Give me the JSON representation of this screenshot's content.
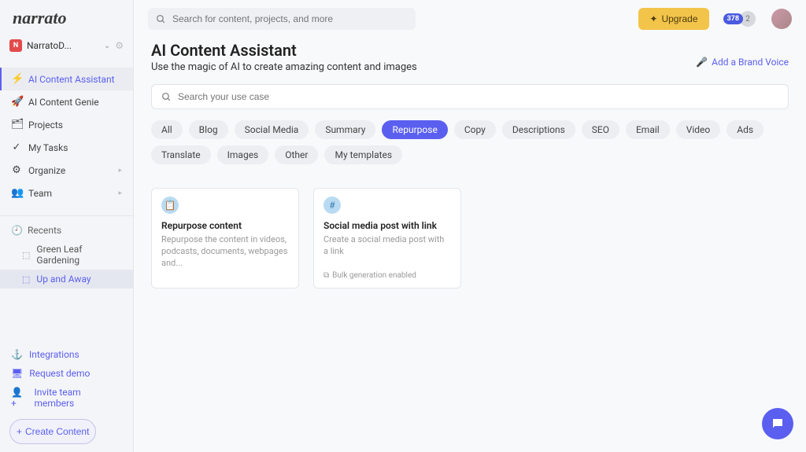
{
  "brand": "narrato",
  "workspace": {
    "badge": "N",
    "name": "NarratoD..."
  },
  "sidebar": {
    "items": [
      {
        "icon": "⚡",
        "label": "AI Content Assistant",
        "active": true
      },
      {
        "icon": "🚀",
        "label": "AI Content Genie"
      },
      {
        "icon": "🗂",
        "label": "Projects"
      },
      {
        "icon": "✓",
        "label": "My Tasks"
      },
      {
        "icon": "⚙",
        "label": "Organize",
        "expandable": true
      },
      {
        "icon": "👥",
        "label": "Team",
        "expandable": true
      }
    ],
    "recents": {
      "header": "Recents",
      "items": [
        {
          "label": "Green Leaf Gardening"
        },
        {
          "label": "Up and Away",
          "active": true
        }
      ]
    },
    "bottom": [
      {
        "icon": "⚓",
        "label": "Integrations"
      },
      {
        "icon": "🖥",
        "label": "Request demo"
      },
      {
        "icon": "👤+",
        "label": "Invite team members"
      }
    ],
    "create_label": "Create Content"
  },
  "topbar": {
    "search_placeholder": "Search for content, projects, and more",
    "upgrade_label": "Upgrade",
    "badge_count": "378",
    "circle_count": "2"
  },
  "page": {
    "title": "AI Content Assistant",
    "subtitle": "Use the magic of AI to create amazing content and images",
    "brand_voice_label": "Add a Brand Voice",
    "usecase_placeholder": "Search your use case"
  },
  "filters": [
    "All",
    "Blog",
    "Social Media",
    "Summary",
    "Repurpose",
    "Copy",
    "Descriptions",
    "SEO",
    "Email",
    "Video",
    "Ads",
    "Translate",
    "Images",
    "Other",
    "My templates"
  ],
  "filters_active_index": 4,
  "cards": [
    {
      "icon": "📋",
      "title": "Repurpose content",
      "desc": "Repurpose the content in videos, podcasts, documents, webpages and..."
    },
    {
      "icon": "#",
      "title": "Social media post with link",
      "desc": "Create a social media post with a link",
      "footer": "Bulk generation enabled"
    }
  ]
}
